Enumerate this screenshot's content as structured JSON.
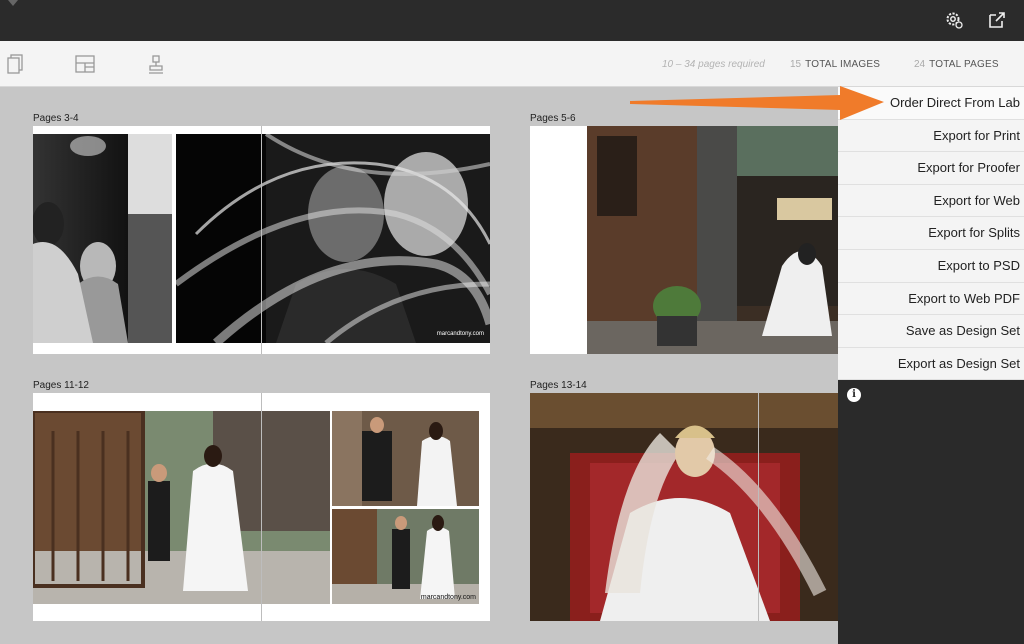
{
  "toolbar": {
    "pages_required": "10 – 34 pages required",
    "total_images_count": "15",
    "total_images_label": "TOTAL IMAGES",
    "total_pages_count": "24",
    "total_pages_label": "TOTAL PAGES"
  },
  "spreads": [
    {
      "label": "Pages 3-4",
      "watermark": "marcandtony.com"
    },
    {
      "label": "Pages 5-6"
    },
    {
      "label": "Pages 11-12",
      "watermark": "marcandtony.com"
    },
    {
      "label": "Pages 13-14"
    }
  ],
  "export_menu": {
    "items": [
      "Order Direct From Lab",
      "Export for Print",
      "Export for Proofer",
      "Export for Web",
      "Export for Splits",
      "Export to PSD",
      "Export to Web PDF",
      "Save as Design Set",
      "Export as Design Set"
    ]
  },
  "colors": {
    "topbar": "#2b2b2b",
    "canvas": "#c6c6c6",
    "arrow": "#f07b2a"
  },
  "icons": [
    "settings-gear-icon",
    "export-share-icon",
    "pages-icon",
    "layout-icon",
    "stamp-icon",
    "info-icon"
  ]
}
